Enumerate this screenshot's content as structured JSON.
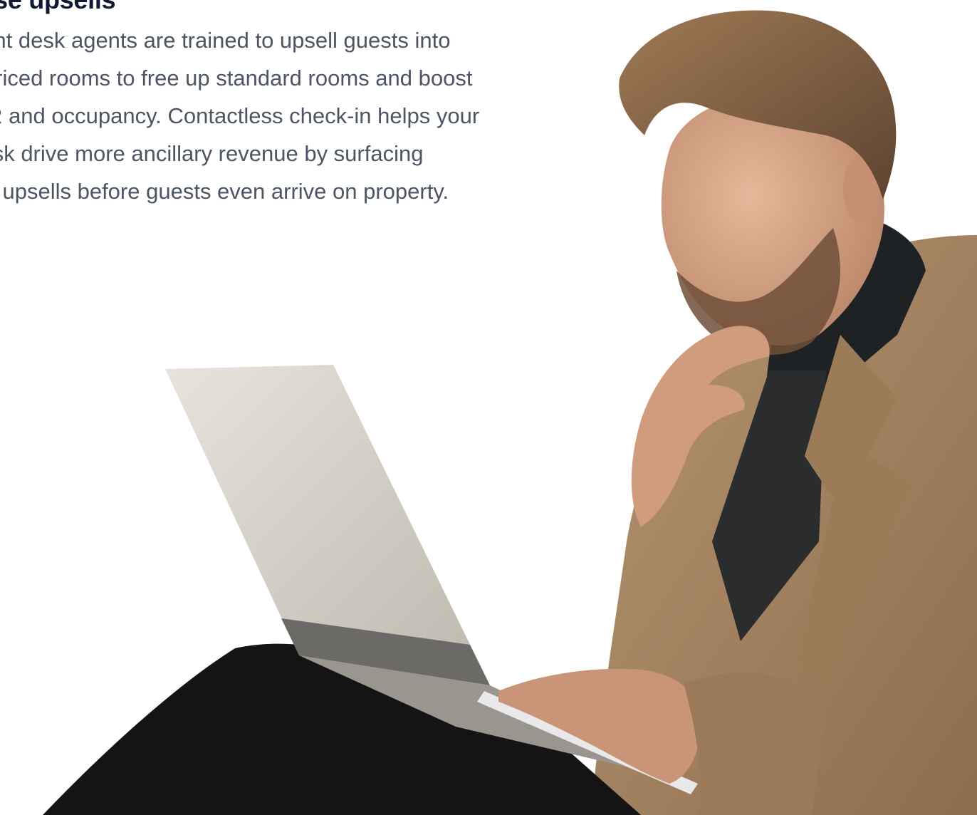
{
  "section": {
    "heading": "rease upsells",
    "body_lines": [
      "t front desk agents are trained to upsell guests into",
      "er-priced rooms to free up standard rooms and boost",
      "  ADR and occupancy. Contactless check-in helps your",
      "t desk drive more ancillary revenue by surfacing",
      "cing upsells before guests even arrive on property."
    ]
  },
  "colors": {
    "heading": "#111a33",
    "body": "#4b5563",
    "background": "#ffffff",
    "coat": "#a88763",
    "laptop": "#d6d1c8",
    "hair": "#7a5a3e",
    "skin": "#d8a88a"
  }
}
